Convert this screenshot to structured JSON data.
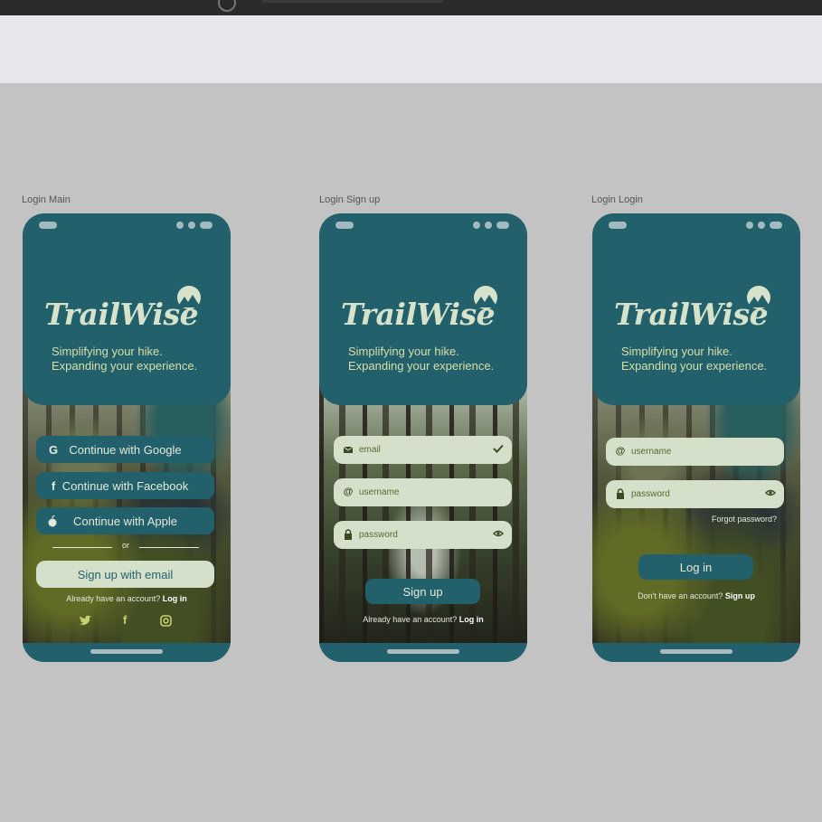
{
  "frames": [
    {
      "label": "Login Main"
    },
    {
      "label": "Login Sign up"
    },
    {
      "label": "Login Login"
    }
  ],
  "brand": {
    "name": "TrailWise",
    "tagline_line1": "Simplifying your hike.",
    "tagline_line2": "Expanding your experience.",
    "colors": {
      "teal": "#22606b",
      "cream": "#d5e0cb",
      "accent": "#d9dfa8"
    }
  },
  "main": {
    "google_label": "Continue with Google",
    "google_icon": "G",
    "facebook_label": "Continue with Facebook",
    "facebook_icon": "f",
    "apple_label": "Continue with Apple",
    "or_label": "or",
    "signup_email_label": "Sign up with email",
    "have_account_text": "Already have an account?",
    "login_link": "Log in",
    "social_icons": [
      "twitter-icon",
      "facebook-icon",
      "instagram-icon"
    ],
    "facebook_social_glyph": "f"
  },
  "signup": {
    "email_placeholder": "email",
    "username_placeholder": "username",
    "password_placeholder": "password",
    "signup_button": "Sign up",
    "have_account_text": "Already have an account?",
    "login_link": "Log in",
    "at_glyph": "@"
  },
  "login": {
    "username_placeholder": "username",
    "password_placeholder": "password",
    "forgot_password": "Forgot password?",
    "login_button": "Log in",
    "no_account_text": "Don't have an account?",
    "signup_link": "Sign up",
    "at_glyph": "@"
  }
}
